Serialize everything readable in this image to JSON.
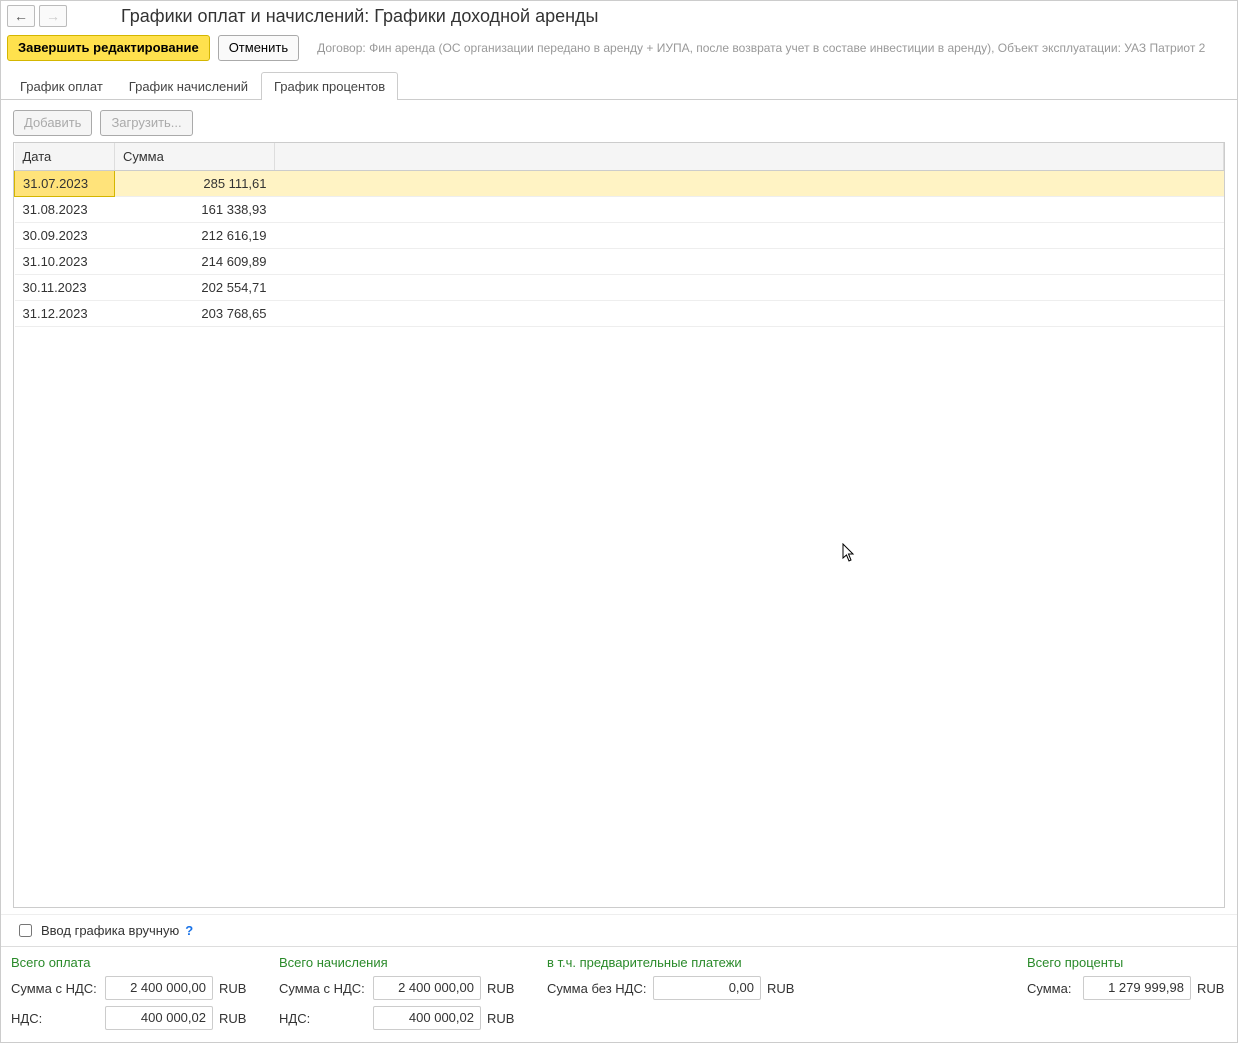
{
  "header": {
    "title": "Графики оплат и начислений: Графики доходной аренды"
  },
  "toolbar": {
    "finish_edit": "Завершить редактирование",
    "cancel": "Отменить",
    "note": "Договор: Фин аренда (ОС организации передано в аренду + ИУПА, после возврата учет в составе инвестиции в аренду), Объект эксплуатации: УАЗ Патриот 2"
  },
  "tabs": {
    "payments": "График оплат",
    "accruals": "График начислений",
    "interest": "График процентов"
  },
  "subtoolbar": {
    "add": "Добавить",
    "load": "Загрузить..."
  },
  "table": {
    "columns": {
      "date": "Дата",
      "sum": "Сумма"
    },
    "rows": [
      {
        "date": "31.07.2023",
        "sum": "285 111,61",
        "selected": true
      },
      {
        "date": "31.08.2023",
        "sum": "161 338,93"
      },
      {
        "date": "30.09.2023",
        "sum": "212 616,19"
      },
      {
        "date": "31.10.2023",
        "sum": "214 609,89"
      },
      {
        "date": "30.11.2023",
        "sum": "202 554,71"
      },
      {
        "date": "31.12.2023",
        "sum": "203 768,65"
      }
    ]
  },
  "manual_check": {
    "label": "Ввод графика вручную",
    "help": "?"
  },
  "totals": {
    "currency": "RUB",
    "payment": {
      "title": "Всего оплата",
      "sum_vat_label": "Сумма с НДС:",
      "sum_vat_value": "2 400 000,00",
      "vat_label": "НДС:",
      "vat_value": "400 000,02"
    },
    "accrual": {
      "title": "Всего начисления",
      "sum_vat_label": "Сумма с НДС:",
      "sum_vat_value": "2 400 000,00",
      "vat_label": "НДС:",
      "vat_value": "400 000,02"
    },
    "prepay": {
      "title": "в т.ч. предварительные платежи",
      "sum_novat_label": "Сумма без НДС:",
      "sum_novat_value": "0,00"
    },
    "interest": {
      "title": "Всего проценты",
      "sum_label": "Сумма:",
      "sum_value": "1 279 999,98"
    }
  }
}
